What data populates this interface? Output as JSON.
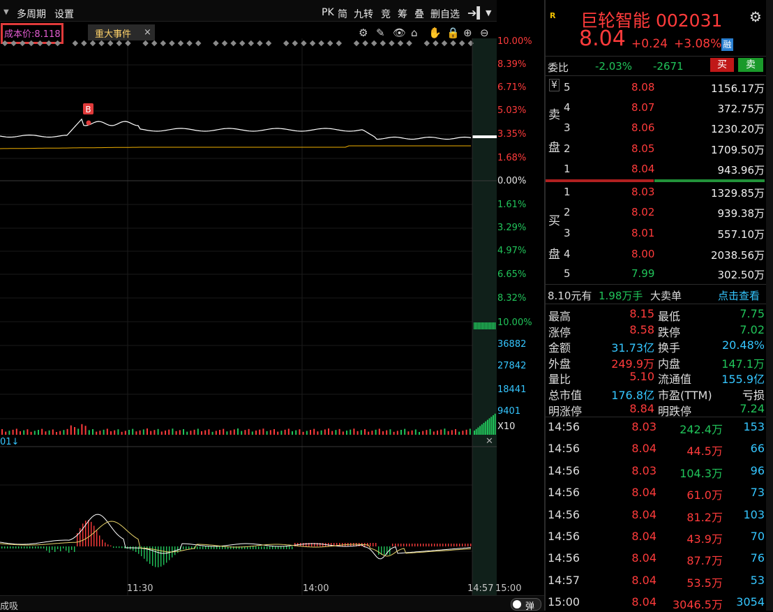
{
  "toolbar": {
    "dropdown": "多周期",
    "settings": "设置",
    "pk": "PK",
    "simple": "简",
    "nine": "九转",
    "bid": "竞",
    "chip": "筹",
    "overlay": "叠",
    "remove_fav": "删自选"
  },
  "chart": {
    "cost_price": "成本价:8.118",
    "event_tab": "重大事件",
    "event_close": "×",
    "buy_marker": "B",
    "upper_pct_labels": [
      "10.00%",
      "8.39%",
      "6.71%",
      "5.03%",
      "3.35%",
      "1.68%",
      "0.00%"
    ],
    "lower_pct_labels": [
      "1.61%",
      "3.29%",
      "4.97%",
      "6.65%",
      "8.32%",
      "10.00%"
    ],
    "volume_labels": [
      "36882",
      "27842",
      "18441",
      "9401",
      "X10"
    ],
    "indicator_label": "01↓",
    "time_labels": [
      "11:30",
      "14:00",
      "14:57",
      "15:00"
    ],
    "bottom_left": "成吸",
    "popup": "弹",
    "colors": {
      "price_line": "#ffffff",
      "avg_line": "#f0b000",
      "up": "#ff3b3b",
      "down": "#21c45a",
      "grid": "#1c1c1c"
    }
  },
  "quote": {
    "name_code": "巨轮智能 002031",
    "price": "8.04",
    "change": "+0.24",
    "change_pct": "+3.08%",
    "tag": "融",
    "weibi_label": "委比",
    "weibi_pct": "-2.03%",
    "weicha": "-2671",
    "buy_btn": "买",
    "sell_btn": "卖"
  },
  "orderbook": {
    "sell_label_1": "卖",
    "sell_label_2": "盘",
    "buy_label_1": "买",
    "buy_label_2": "盘",
    "yen": "¥",
    "sells": [
      {
        "level": "5",
        "price": "8.08",
        "vol": "1156.17万"
      },
      {
        "level": "4",
        "price": "8.07",
        "vol": "372.75万"
      },
      {
        "level": "3",
        "price": "8.06",
        "vol": "1230.20万"
      },
      {
        "level": "2",
        "price": "8.05",
        "vol": "1709.50万"
      },
      {
        "level": "1",
        "price": "8.04",
        "vol": "943.96万"
      }
    ],
    "buys": [
      {
        "level": "1",
        "price": "8.03",
        "vol": "1329.85万"
      },
      {
        "level": "2",
        "price": "8.02",
        "vol": "939.38万"
      },
      {
        "level": "3",
        "price": "8.01",
        "vol": "557.10万"
      },
      {
        "level": "4",
        "price": "8.00",
        "vol": "2038.56万"
      },
      {
        "level": "5",
        "price": "7.99",
        "vol": "302.50万"
      }
    ],
    "big_order_price": "8.10元有",
    "big_order_vol": "1.98万手",
    "big_order_label": "大卖单",
    "big_order_link": "点击查看"
  },
  "stats": [
    {
      "l1": "最高",
      "v1": "8.15",
      "c1": "red",
      "l2": "最低",
      "v2": "7.75",
      "c2": "green"
    },
    {
      "l1": "涨停",
      "v1": "8.58",
      "c1": "red",
      "l2": "跌停",
      "v2": "7.02",
      "c2": "green"
    },
    {
      "l1": "金额",
      "v1": "31.73亿",
      "c1": "cyan",
      "l2": "换手",
      "v2": "20.48%",
      "c2": "cyan"
    },
    {
      "l1": "外盘",
      "v1": "249.9万",
      "c1": "red",
      "l2": "内盘",
      "v2": "147.1万",
      "c2": "green"
    },
    {
      "l1": "量比",
      "v1": "5.10",
      "c1": "red",
      "l2": "流通值",
      "v2": "155.9亿",
      "c2": "cyan"
    },
    {
      "l1": "总市值",
      "v1": "176.8亿",
      "c1": "cyan",
      "l2": "市盈(TTM)",
      "v2": "亏损",
      "c2": "white"
    },
    {
      "l1": "明涨停",
      "v1": "8.84",
      "c1": "red",
      "l2": "明跌停",
      "v2": "7.24",
      "c2": "green"
    }
  ],
  "trades": [
    {
      "time": "14:56",
      "price": "8.03",
      "vol": "242.4万",
      "vc": "green",
      "n": "153"
    },
    {
      "time": "14:56",
      "price": "8.04",
      "vol": "44.5万",
      "vc": "red",
      "n": "66"
    },
    {
      "time": "14:56",
      "price": "8.03",
      "vol": "104.3万",
      "vc": "green",
      "n": "96"
    },
    {
      "time": "14:56",
      "price": "8.04",
      "vol": "61.0万",
      "vc": "red",
      "n": "73"
    },
    {
      "time": "14:56",
      "price": "8.04",
      "vol": "81.2万",
      "vc": "red",
      "n": "103"
    },
    {
      "time": "14:56",
      "price": "8.04",
      "vol": "43.9万",
      "vc": "red",
      "n": "70"
    },
    {
      "time": "14:56",
      "price": "8.04",
      "vol": "87.7万",
      "vc": "red",
      "n": "76"
    },
    {
      "time": "14:57",
      "price": "8.04",
      "vol": "53.5万",
      "vc": "red",
      "n": "53"
    },
    {
      "time": "15:00",
      "price": "8.04",
      "vol": "3046.5万",
      "vc": "red",
      "n": "3054"
    }
  ]
}
